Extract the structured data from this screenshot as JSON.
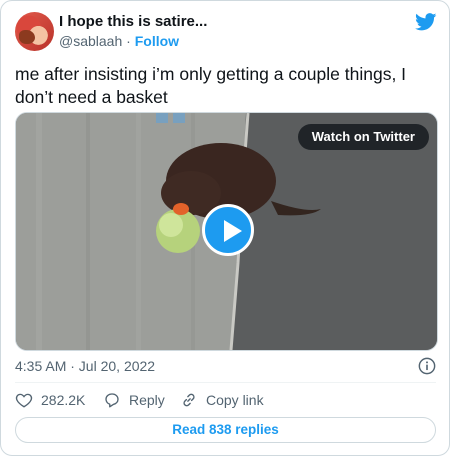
{
  "author": {
    "display_name": "I hope this is satire...",
    "handle": "@sablaah",
    "separator": "·",
    "follow_label": "Follow",
    "avatar_icon": "profile-avatar"
  },
  "tweet": {
    "text": "me after insisting i’m only getting a couple things, I don’t need a basket",
    "timestamp": "4:35 AM · Jul 20, 2022"
  },
  "media": {
    "watch_label": "Watch on Twitter",
    "play_icon": "play-icon"
  },
  "actions": {
    "like_count": "282.2K",
    "reply_label": "Reply",
    "copy_label": "Copy link"
  },
  "replies_button": "Read 838 replies",
  "colors": {
    "accent": "#1d9bf0",
    "text": "#0f1419",
    "secondary": "#536471",
    "border": "#cfd9de"
  }
}
